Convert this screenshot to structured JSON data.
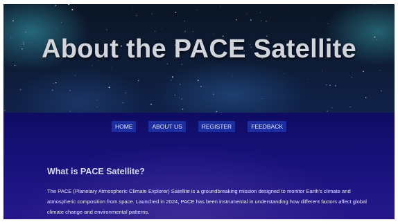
{
  "hero": {
    "title": "About the PACE Satellite"
  },
  "nav": {
    "items": [
      "HOME",
      "ABOUT US",
      "REGISTER",
      "FEEDBACK"
    ]
  },
  "section": {
    "title": "What is PACE Satellite?",
    "text": "The PACE (Planetary Atmospheric Climate Explorer) Satellite is a groundbreaking mission designed to monitor Earth's climate and atmospheric composition from space. Launched in 2024, PACE has been instrumental in understanding how different factors affect global climate change and environmental patterns."
  }
}
